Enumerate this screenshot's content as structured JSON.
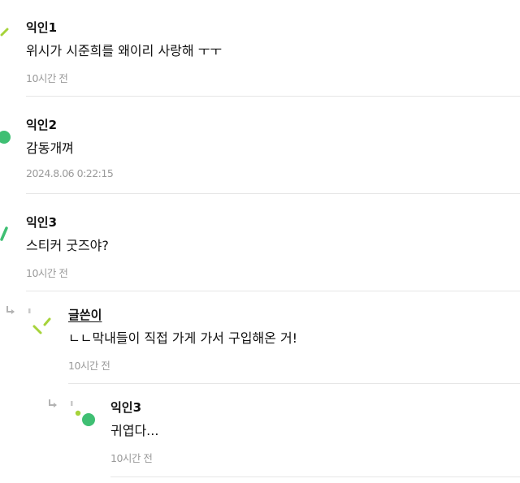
{
  "comments": [
    {
      "author": "익인1",
      "text": "위시가 시준희를 왜이리 사랑해 ㅜㅜ",
      "time": "10시간 전"
    },
    {
      "author": "익인2",
      "text": "감동개껴",
      "time": "2024.8.06 0:22:15"
    },
    {
      "author": "익인3",
      "text": "스티커 굿즈야?",
      "time": "10시간 전"
    },
    {
      "author": "글쓴이",
      "text": "ㄴㄴ막내들이 직접 가게 가서 구입해온 거!",
      "time": "10시간 전"
    },
    {
      "author": "익인3",
      "text": "귀엽다...",
      "time": "10시간 전"
    }
  ],
  "colors": {
    "green": "#3fbf73",
    "lime": "#a6d33a",
    "grey_text": "#9a9a9a"
  },
  "icons": [
    "reply-arrow-icon",
    "avatar-icon"
  ]
}
